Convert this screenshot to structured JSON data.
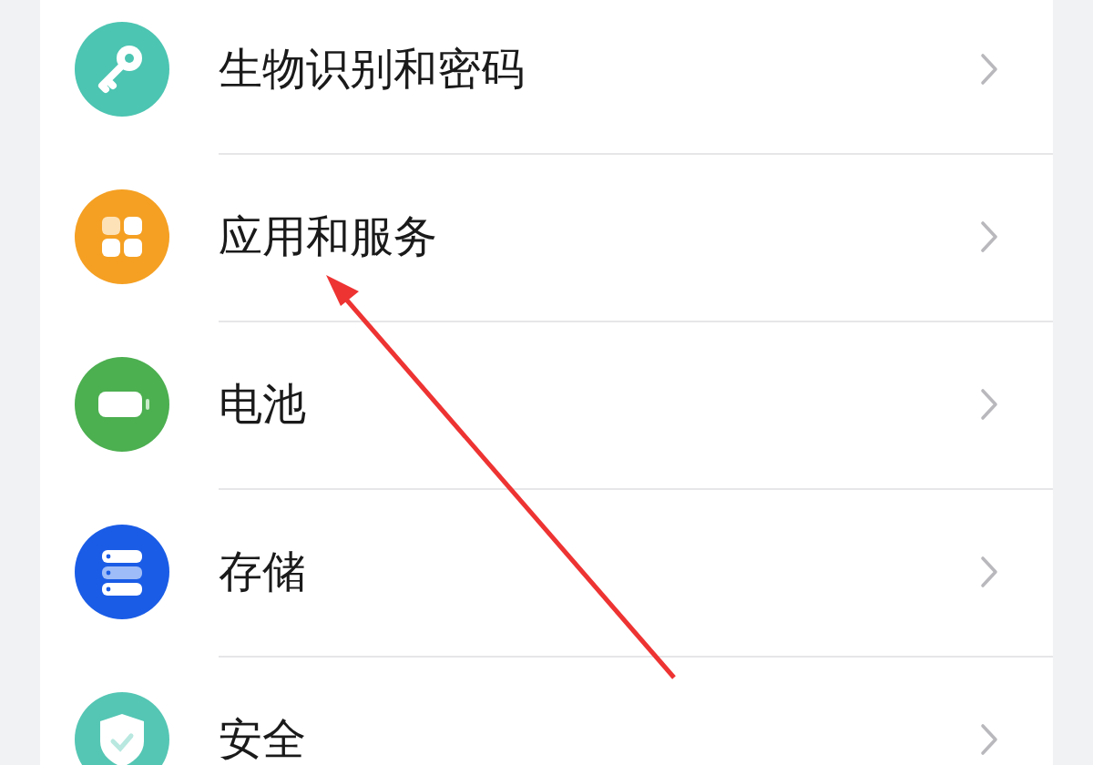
{
  "settings": [
    {
      "label": "生物识别和密码",
      "color": "#4cc5b2"
    },
    {
      "label": "应用和服务",
      "color": "#f5a023"
    },
    {
      "label": "电池",
      "color": "#4caf50"
    },
    {
      "label": "存储",
      "color": "#1a5ce6"
    },
    {
      "label": "安全",
      "color": "#55c6b4"
    }
  ]
}
